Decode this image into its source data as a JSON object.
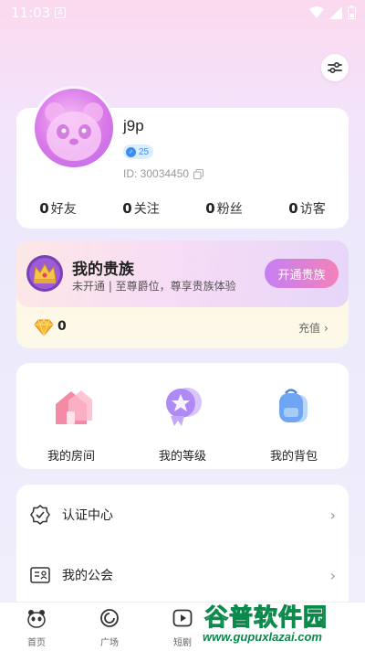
{
  "status_bar": {
    "time": "11:03",
    "a_badge": "A"
  },
  "profile": {
    "username": "j9p",
    "gender_symbol": "♂",
    "age": "25",
    "id_text": "ID: 30034450",
    "stats": [
      {
        "num": "0",
        "label": "好友"
      },
      {
        "num": "0",
        "label": "关注"
      },
      {
        "num": "0",
        "label": "粉丝"
      },
      {
        "num": "0",
        "label": "访客"
      }
    ]
  },
  "noble": {
    "title": "我的贵族",
    "subtitle": "未开通 | 至尊爵位，尊享贵族体验",
    "open_button": "开通贵族",
    "diamond_count": "0",
    "recharge_label": "充值"
  },
  "features": [
    {
      "label": "我的房间",
      "icon": "house-icon"
    },
    {
      "label": "我的等级",
      "icon": "level-badge-icon"
    },
    {
      "label": "我的背包",
      "icon": "backpack-icon"
    }
  ],
  "menu": [
    {
      "label": "认证中心",
      "icon": "verify-icon"
    },
    {
      "label": "我的公会",
      "icon": "guild-card-icon"
    }
  ],
  "bottom_nav": [
    {
      "label": "首页",
      "icon": "panda-home-icon"
    },
    {
      "label": "广场",
      "icon": "square-icon"
    },
    {
      "label": "短剧",
      "icon": "play-icon"
    }
  ],
  "watermark": {
    "main": "谷普软件园",
    "url": "www.gupuxlazai.com"
  },
  "colors": {
    "accent_purple": "#c580f4",
    "accent_pink": "#f281b8",
    "gender_blue": "#3b8cf0",
    "watermark_green": "#0a8a4b"
  }
}
